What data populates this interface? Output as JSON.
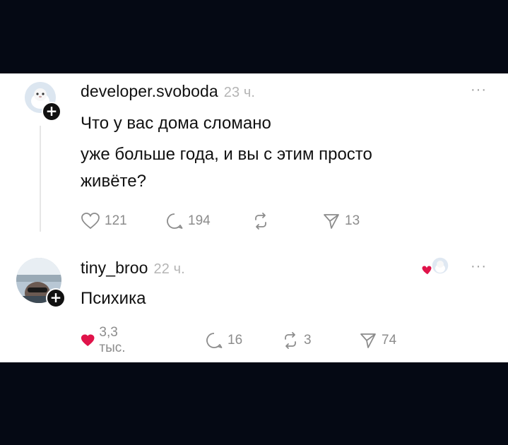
{
  "posts": [
    {
      "username": "developer.svoboda",
      "time": "23 ч.",
      "more_label": "···",
      "text_lines": [
        "Что у вас дома сломано",
        "уже больше года, и вы с этим просто",
        "живёте?"
      ],
      "likes": "121",
      "comments": "194",
      "reposts": "",
      "shares": "13",
      "liked": false
    },
    {
      "username": "tiny_broo",
      "time": "22 ч.",
      "more_label": "···",
      "text_lines": [
        "Психика"
      ],
      "likes": "3,3 тыс.",
      "comments": "16",
      "reposts": "3",
      "shares": "74",
      "liked": true
    }
  ],
  "colors": {
    "background": "#050914",
    "card": "#ffffff",
    "like_active": "#e0134a",
    "muted": "#8c8c8c"
  },
  "icons": [
    "heart-icon",
    "comment-icon",
    "repost-icon",
    "share-icon",
    "more-icon",
    "plus-icon"
  ]
}
